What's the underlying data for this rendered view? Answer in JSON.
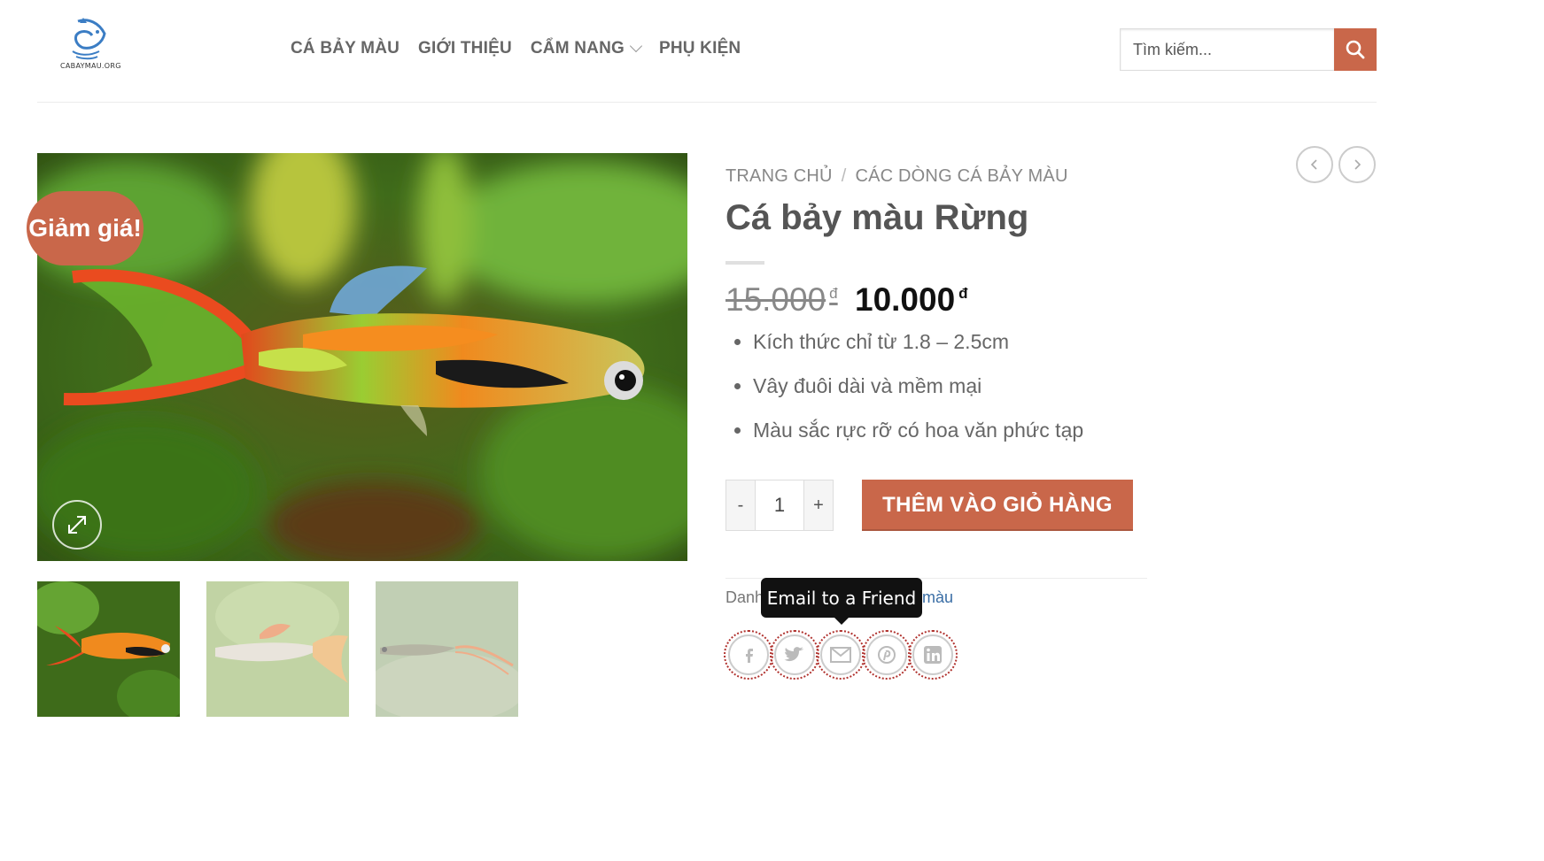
{
  "header": {
    "logo_text": "CABAYMAU.ORG",
    "nav": [
      {
        "label": "CÁ BẢY MÀU"
      },
      {
        "label": "GIỚI THIỆU"
      },
      {
        "label": "CẨM NANG"
      },
      {
        "label": "PHỤ KIỆN"
      }
    ],
    "search": {
      "placeholder": "Tìm kiếm..."
    }
  },
  "gallery": {
    "sale_badge": "Giảm giá!"
  },
  "product": {
    "breadcrumb": [
      "TRANG CHỦ",
      "/",
      "CÁC DÒNG CÁ BẢY MÀU"
    ],
    "title": "Cá bảy màu Rừng",
    "price_old": "15.000",
    "price_new": "10.000",
    "currency": "đ",
    "features": [
      "Kích thức chỉ từ 1.8 – 2.5cm",
      "Vây đuôi dài và mềm mại",
      "Màu sắc rực rỡ có hoa văn phức tạp"
    ],
    "quantity": "1",
    "qty_minus": "-",
    "qty_plus": "+",
    "add_to_cart": "THÊM VÀO GIỎ HÀNG",
    "meta_label": "Danh",
    "meta_link": "màu",
    "tooltip": "Email to a Friend"
  },
  "colors": {
    "accent": "#c9674a",
    "link": "#3a6ea5"
  }
}
